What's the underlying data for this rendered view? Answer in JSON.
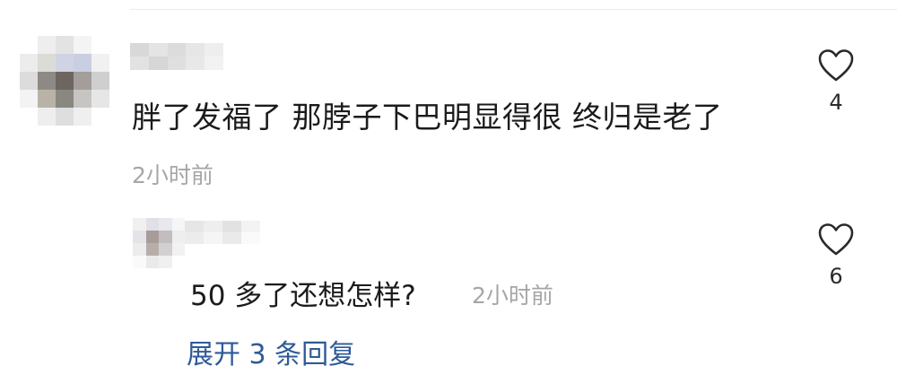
{
  "comment": {
    "text": "胖了发福了 那脖子下巴明显得很 终归是老了",
    "time": "2小时前",
    "like_count": "4"
  },
  "reply": {
    "text": "50 多了还想怎样?",
    "time": "2小时前",
    "like_count": "6"
  },
  "expand_label": "展开 3 条回复",
  "icons": {
    "like": "heart-outline-icon"
  },
  "colors": {
    "text": "#1b1b1b",
    "muted": "#a6a6a6",
    "link": "#2e5a97"
  }
}
